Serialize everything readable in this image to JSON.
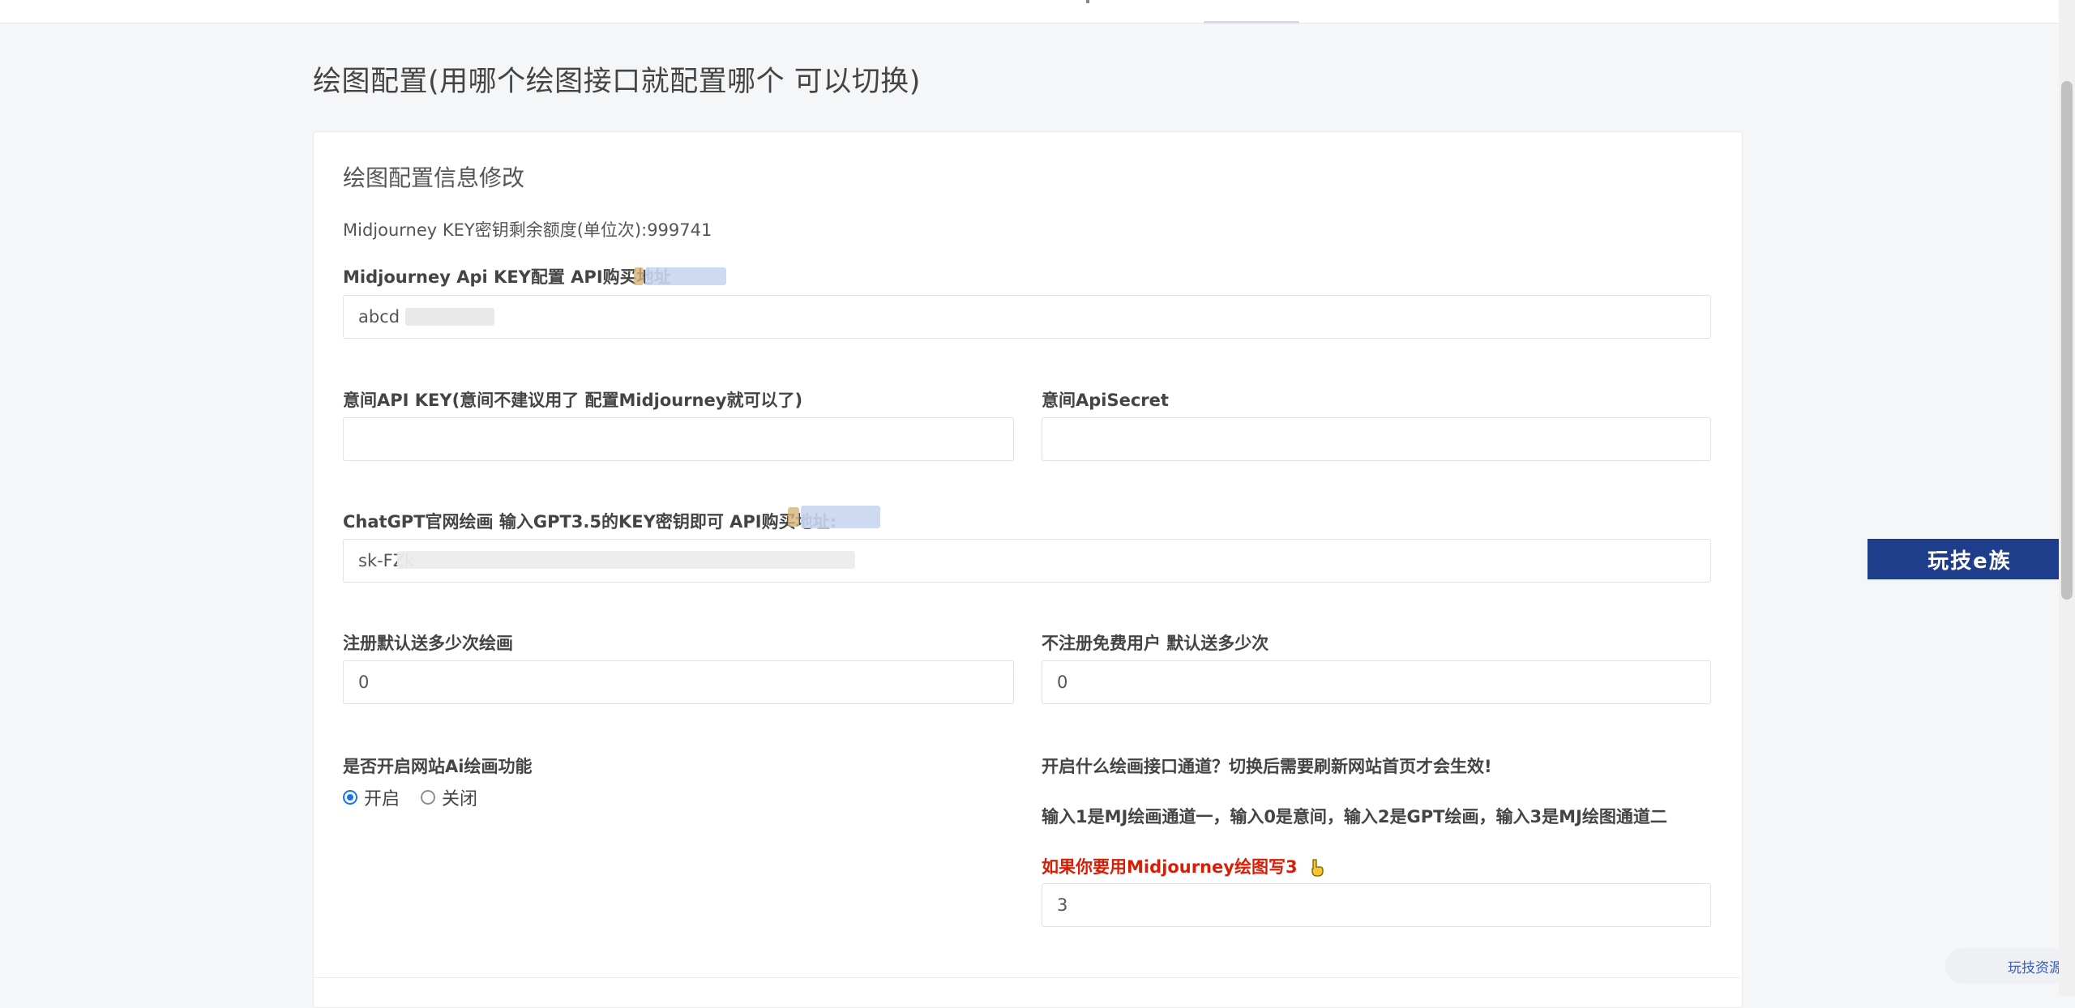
{
  "page": {
    "title": "绘图配置(用哪个绘图接口就配置哪个 可以切换)"
  },
  "card": {
    "title": "绘图配置信息修改",
    "quota_text": "Midjourney KEY密钥剩余额度(单位次):999741"
  },
  "fields": {
    "mj_key": {
      "label": "Midjourney Api KEY配置 API购买地址",
      "value": "abcd"
    },
    "yijian_key": {
      "label": "意间API KEY(意间不建议用了 配置Midjourney就可以了)",
      "value": ""
    },
    "yijian_secret": {
      "label": "意间ApiSecret",
      "value": ""
    },
    "gpt_key": {
      "label": "ChatGPT官网绘画 输入GPT3.5的KEY密钥即可 API购买地址:",
      "value": "sk-FZk"
    },
    "register_count": {
      "label": "注册默认送多少次绘画",
      "value": "0"
    },
    "guest_count": {
      "label": "不注册免费用户 默认送多少次",
      "value": "0"
    },
    "ai_enable": {
      "label": "是否开启网站Ai绘画功能",
      "options": [
        "开启",
        "关闭"
      ],
      "selected": "开启"
    },
    "channel": {
      "label": "开启什么绘画接口通道？切换后需要刷新网站首页才会生效!",
      "help": "输入1是MJ绘画通道一，输入0是意间，输入2是GPT绘画，输入3是MJ绘图通道二",
      "hint": "如果你要用Midjourney绘图写3",
      "value": "3"
    }
  },
  "watermarks": {
    "badge": "玩技e族",
    "small": "玩技资源"
  },
  "colors": {
    "accent": "#1a73e8",
    "hint_red": "#d81e06",
    "badge_bg": "#1e3e8c"
  }
}
